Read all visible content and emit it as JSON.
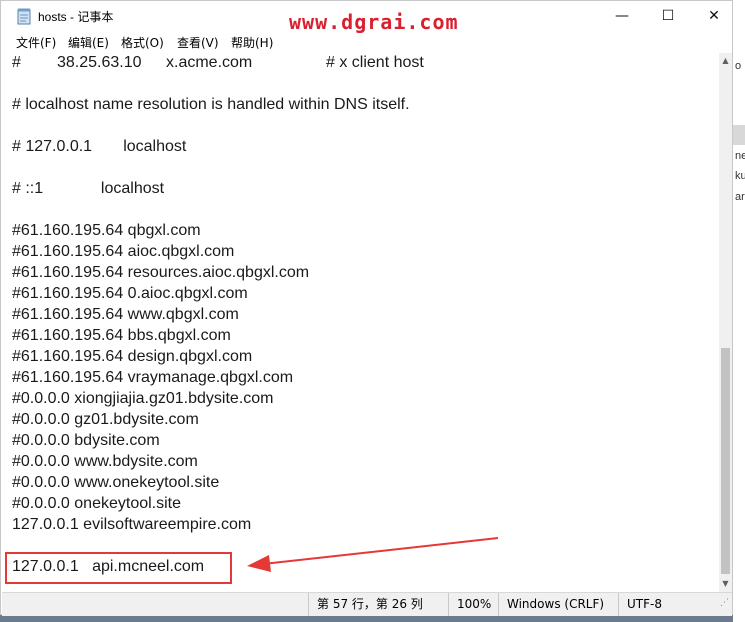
{
  "window": {
    "title": "hosts - 记事本",
    "minimize": "—",
    "maximize": "☐",
    "close": "✕"
  },
  "watermark": "www.dgrai.com",
  "menu": [
    "文件(F)",
    "编辑(E)",
    "格式(O)",
    "查看(V)",
    "帮助(H)"
  ],
  "editor": {
    "first_line": {
      "hash": "#",
      "ip": "38.25.63.10",
      "host": "x.acme.com",
      "comment": "# x client host"
    },
    "lines": [
      "# localhost name resolution is handled within DNS itself.",
      "# 127.0.0.1       localhost",
      "# ::1             localhost",
      "#61.160.195.64 qbgxl.com",
      "#61.160.195.64 aioc.qbgxl.com",
      "#61.160.195.64 resources.aioc.qbgxl.com",
      "#61.160.195.64 0.aioc.qbgxl.com",
      "#61.160.195.64 www.qbgxl.com",
      "#61.160.195.64 bbs.qbgxl.com",
      "#61.160.195.64 design.qbgxl.com",
      "#61.160.195.64 vraymanage.qbgxl.com",
      "#0.0.0.0 xiongjiajia.gz01.bdysite.com",
      "#0.0.0.0 gz01.bdysite.com",
      "#0.0.0.0 bdysite.com",
      "#0.0.0.0 www.bdysite.com",
      "#0.0.0.0 www.onekeytool.site",
      "#0.0.0.0 onekeytool.site",
      "127.0.0.1 evilsoftwareempire.com",
      "127.0.0.1   api.mcneel.com"
    ]
  },
  "status": {
    "position": "第 57 行，第 26 列",
    "zoom": "100%",
    "line_ending": "Windows (CRLF)",
    "encoding": "UTF-8"
  },
  "background_fragments": [
    "o",
    "ne",
    "ku",
    "ar"
  ],
  "colors": {
    "annotation": "#e53935",
    "watermark": "#d8202f"
  }
}
